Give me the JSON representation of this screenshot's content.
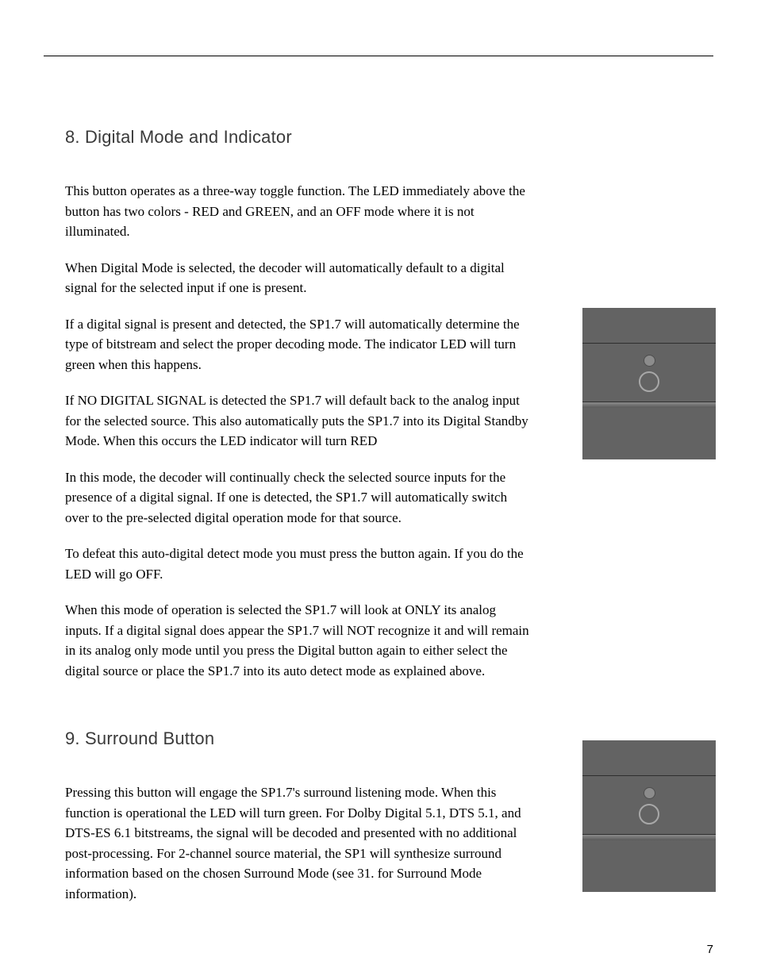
{
  "sections": [
    {
      "heading": "8. Digital Mode and Indicator",
      "paragraphs": [
        "This button operates as a three-way toggle function.  The LED immediately above the button has two colors - RED and GREEN, and an OFF mode where it is not illuminated.",
        "When Digital Mode is selected, the decoder will automatically default to a digital signal for the selected input if one is present.",
        "If a digital signal is present and detected, the SP1.7 will automatically determine the type of bitstream and select the proper decoding mode. The indicator LED will turn green when this happens.",
        "If NO DIGITAL SIGNAL is detected the SP1.7 will default back to the analog input for the selected source. This also automatically puts the SP1.7 into its Digital Standby Mode.  When this occurs the LED indicator will turn RED",
        "In this mode, the decoder will continually check the selected source inputs for the presence of a digital signal. If one is detected, the SP1.7 will automatically switch over to the pre-selected digital operation mode for that source.",
        "To defeat this auto-digital detect mode you must press the button again. If you do the LED will go OFF.",
        "When this mode of operation is selected the SP1.7 will look at ONLY its analog inputs. If a digital signal does appear the SP1.7 will NOT recognize it and will remain in its analog only mode until you press the Digital button again to either select the digital source or place the SP1.7 into its auto detect mode as explained above."
      ]
    },
    {
      "heading": "9. Surround Button",
      "paragraphs": [
        "Pressing this button will engage the SP1.7's surround listening mode. When this function is operational the LED will turn green. For Dolby Digital 5.1, DTS 5.1, and DTS-ES 6.1 bitstreams, the signal will be decoded and presented with no additional post-processing.  For 2-channel source material, the SP1 will synthesize surround information based on the chosen Surround Mode (see 31. for Surround Mode information)."
      ]
    }
  ],
  "page_number": "7"
}
